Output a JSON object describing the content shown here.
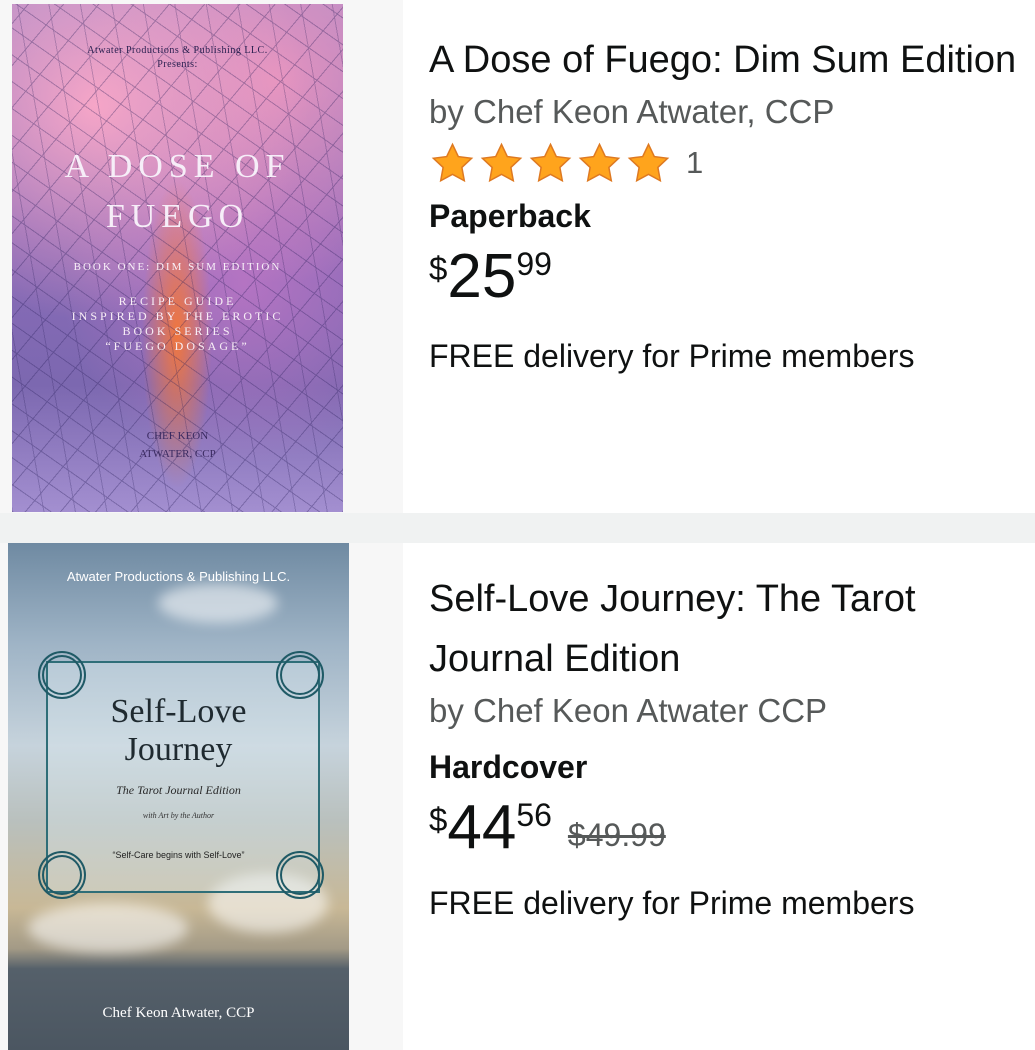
{
  "results": [
    {
      "title": "A Dose of Fuego: Dim Sum Edition",
      "author": "by Chef Keon Atwater, CCP",
      "rating_stars": 5,
      "rating_count": "1",
      "format": "Paperback",
      "price": {
        "currency": "$",
        "whole": "25",
        "fraction": "99"
      },
      "delivery": "FREE delivery for Prime members",
      "cover": {
        "publisher": "Atwater Productions & Publishing LLC.",
        "presents": "Presents:",
        "title_line1": "A DOSE OF",
        "title_line2": "FUEGO",
        "subtitle": "BOOK ONE: DIM SUM EDITION",
        "desc_line1": "RECIPE GUIDE",
        "desc_line2": "INSPIRED BY THE EROTIC",
        "desc_line3": "BOOK SERIES",
        "desc_line4": "“FUEGO DOSAGE”",
        "author_line1": "CHEF KEON",
        "author_line2": "ATWATER, CCP"
      }
    },
    {
      "title": "Self-Love Journey: The Tarot Journal Edition",
      "author": "by Chef Keon Atwater CCP",
      "format": "Hardcover",
      "price": {
        "currency": "$",
        "whole": "44",
        "fraction": "56"
      },
      "list_price": "$49.99",
      "delivery": "FREE delivery for Prime members",
      "cover": {
        "publisher": "Atwater Productions & Publishing LLC.",
        "title_line1": "Self-Love",
        "title_line2": "Journey",
        "subtitle": "The Tarot Journal Edition",
        "subtitle2": "with Art by the Author",
        "quote": "“Self-Care begins with Self-Love”",
        "author": "Chef Keon Atwater, CCP"
      }
    }
  ],
  "colors": {
    "star": "#ffa41c",
    "star_border": "#de7921",
    "price_text": "#0f1111",
    "muted": "#565959"
  },
  "icons": {
    "rating": "star-icon"
  }
}
